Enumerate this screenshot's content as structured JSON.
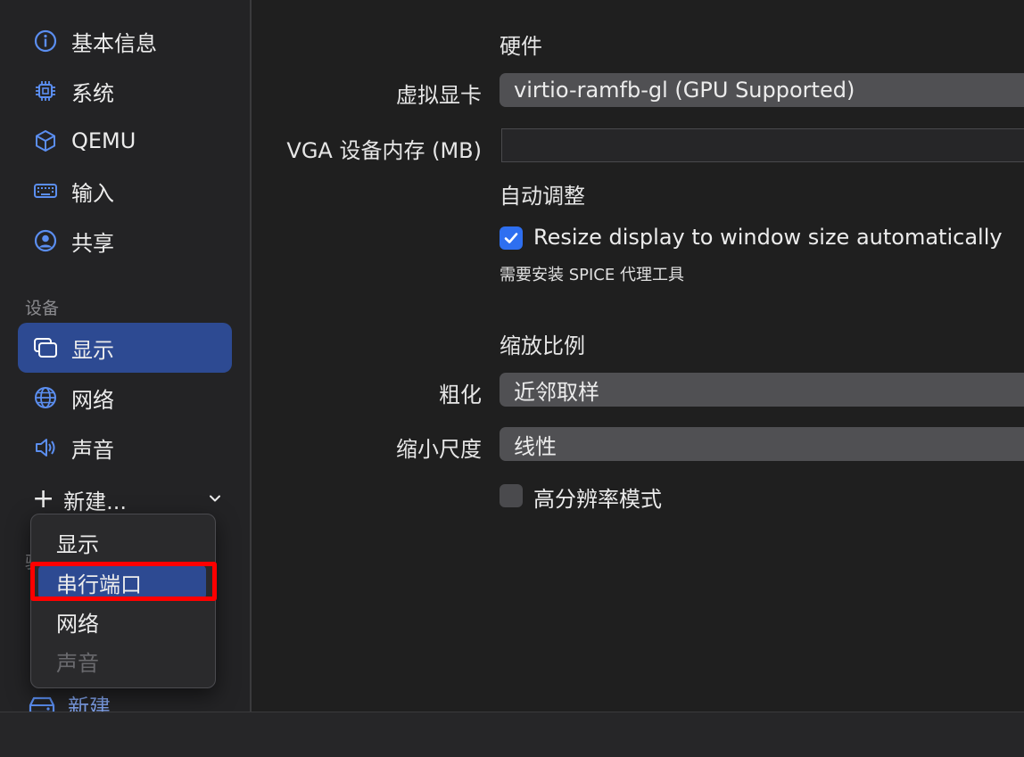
{
  "sidebar": {
    "items": [
      {
        "label": "基本信息",
        "icon": "info-icon"
      },
      {
        "label": "系统",
        "icon": "cpu-icon"
      },
      {
        "label": "QEMU",
        "icon": "cube-icon"
      },
      {
        "label": "输入",
        "icon": "keyboard-icon"
      },
      {
        "label": "共享",
        "icon": "person-circle-icon"
      }
    ],
    "devices_section": "设备",
    "devices": [
      {
        "label": "显示",
        "icon": "display-icon",
        "selected": true
      },
      {
        "label": "网络",
        "icon": "globe-icon"
      },
      {
        "label": "声音",
        "icon": "speaker-icon"
      }
    ],
    "new_button": "新建...",
    "new_button_2": "新建...",
    "partial_section_glyph": "驱"
  },
  "dropdown": {
    "items": [
      {
        "label": "显示",
        "state": "normal"
      },
      {
        "label": "串行端口",
        "state": "highlighted"
      },
      {
        "label": "网络",
        "state": "normal"
      },
      {
        "label": "声音",
        "state": "disabled"
      }
    ],
    "annotation_color": "#ff0000"
  },
  "main": {
    "hardware_title": "硬件",
    "gpu_label": "虚拟显卡",
    "gpu_value": "virtio-ramfb-gl (GPU Supported)",
    "vga_label": "VGA 设备内存 (MB)",
    "vga_value": "",
    "auto_resize_title": "自动调整",
    "resize_checkbox_label": "Resize display to window size automatically",
    "resize_checked": true,
    "spice_note": "需要安装 SPICE 代理工具",
    "scaling_title": "缩放比例",
    "upscale_label": "粗化",
    "upscale_value": "近邻取样",
    "downscale_label": "缩小尺度",
    "downscale_value": "线性",
    "retina_label": "高分辨率模式",
    "retina_checked": false
  },
  "colors": {
    "accent": "#2d4a92",
    "checkbox_blue": "#2e6ff0",
    "link_blue": "#7fa1ea"
  }
}
